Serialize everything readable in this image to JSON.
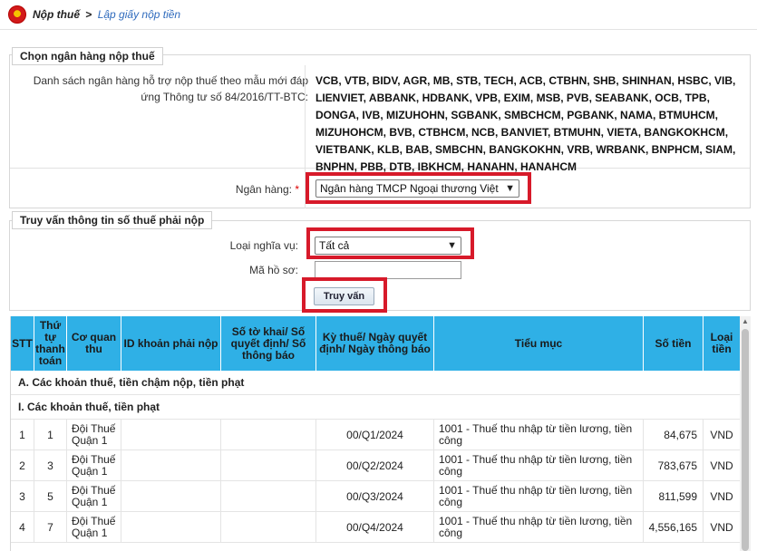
{
  "breadcrumb": {
    "root": "Nộp thuế",
    "separator": ">",
    "current": "Lập giấy nộp tiền"
  },
  "bank_section": {
    "legend": "Chọn ngân hàng nộp thuế",
    "list_label": "Danh sách ngân hàng hỗ trợ nộp thuế theo mẫu mới đáp ứng Thông tư số 84/2016/TT-BTC:",
    "bank_lines": [
      "VCB, VTB, BIDV, AGR, MB, STB, TECH, ACB, CTBHN, SHB, SHINHAN, HSBC, VIB,",
      "LIENVIET, ABBANK, HDBANK, VPB, EXIM, MSB, PVB, SEABANK, OCB, TPB,",
      "DONGA, IVB, MIZUHOHN, SGBANK, SMBCHCM, PGBANK, NAMA, BTMUHCM,",
      "MIZUHOHCM, BVB, CTBHCM, NCB, BANVIET, BTMUHN, VIETA, BANGKOKHCM,",
      "VIETBANK, KLB, BAB, SMBCHN, BANGKOKHN, VRB, WRBANK, BNPHCM, SIAM,",
      "BNPHN, PBB, DTB, IBKHCM, HANAHN, HANAHCM"
    ],
    "bank_label": "Ngân hàng:",
    "required_mark": "*",
    "bank_selected": "Ngân hàng TMCP Ngoại thương Việt Nam"
  },
  "query_section": {
    "legend": "Truy vấn thông tin số thuế phải nộp",
    "obligation_label": "Loại nghĩa vụ:",
    "obligation_selected": "Tất cả",
    "dossier_label": "Mã hồ sơ:",
    "dossier_value": "",
    "search_button": "Truy vấn"
  },
  "table": {
    "headers": [
      "STT",
      "Thứ tự thanh toán",
      "Cơ quan thu",
      "ID khoản phải nộp",
      "Số tờ khai/ Số quyết định/ Số thông báo",
      "Kỳ thuế/ Ngày quyết định/ Ngày thông báo",
      "Tiểu mục",
      "Số tiền",
      "Loại tiền"
    ],
    "section_a": "A. Các khoản thuế, tiền chậm nộp, tiền phạt",
    "section_i": "I. Các khoản thuế, tiền phạt",
    "rows": [
      {
        "stt": "1",
        "order": "1",
        "agency": "Đội Thuế Quận 1",
        "id": "",
        "doc_no": "",
        "period": "00/Q1/2024",
        "subitem": "1001 - Thuế thu nhập từ tiền lương, tiền công",
        "amount": "84,675",
        "currency": "VND"
      },
      {
        "stt": "2",
        "order": "3",
        "agency": "Đội Thuế Quận 1",
        "id": "",
        "doc_no": "",
        "period": "00/Q2/2024",
        "subitem": "1001 - Thuế thu nhập từ tiền lương, tiền công",
        "amount": "783,675",
        "currency": "VND"
      },
      {
        "stt": "3",
        "order": "5",
        "agency": "Đội Thuế Quận 1",
        "id": "",
        "doc_no": "",
        "period": "00/Q3/2024",
        "subitem": "1001 - Thuế thu nhập từ tiền lương, tiền công",
        "amount": "811,599",
        "currency": "VND"
      },
      {
        "stt": "4",
        "order": "7",
        "agency": "Đội Thuế Quận 1",
        "id": "",
        "doc_no": "",
        "period": "00/Q4/2024",
        "subitem": "1001 - Thuế thu nhập từ tiền lương, tiền công",
        "amount": "4,556,165",
        "currency": "VND"
      }
    ]
  },
  "colors": {
    "header_blue": "#2fb0e6",
    "highlight_red": "#d71a2a",
    "link_blue": "#2f6bbd"
  }
}
